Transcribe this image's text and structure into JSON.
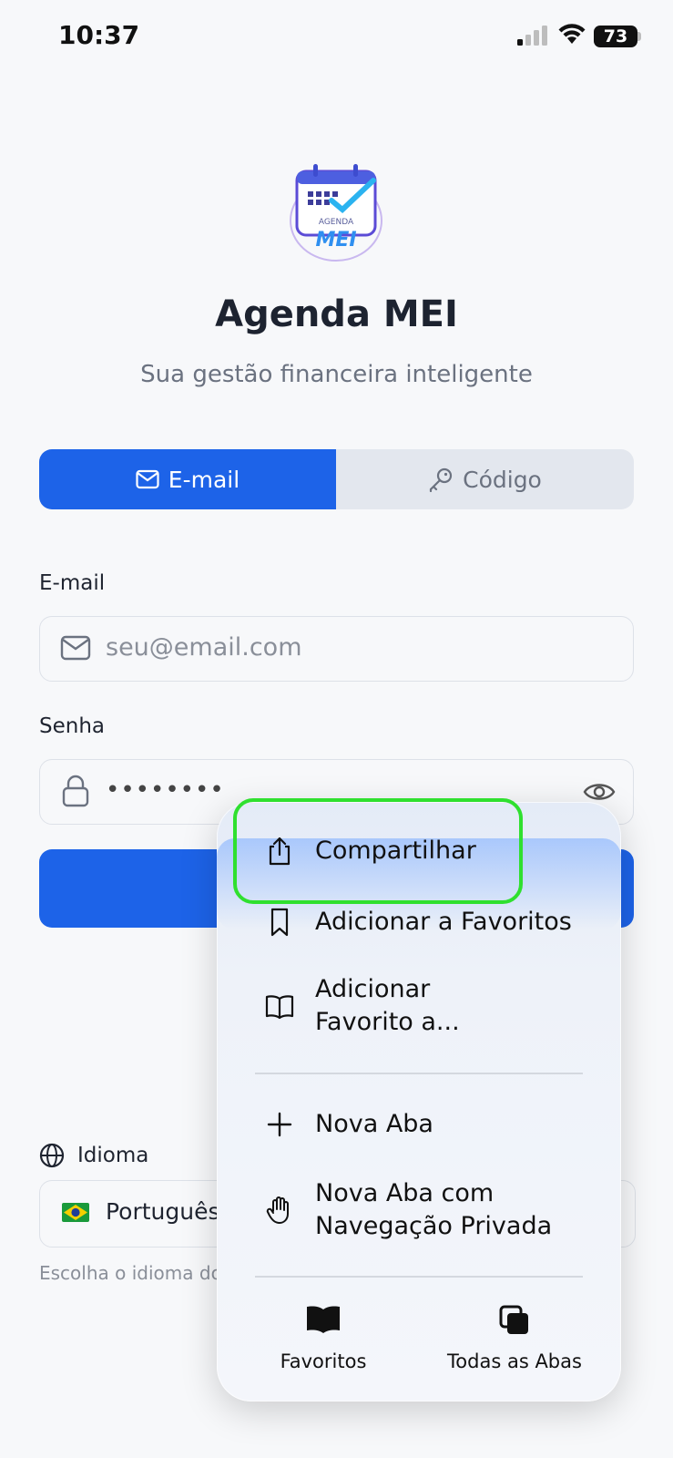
{
  "status": {
    "time": "10:37",
    "battery": "73"
  },
  "app": {
    "logo_top": "AGENDA",
    "logo_main": "MEI",
    "title": "Agenda MEI",
    "subtitle": "Sua gestão financeira inteligente"
  },
  "tabs": {
    "email": "E-mail",
    "code": "Código"
  },
  "form": {
    "email_label": "E-mail",
    "email_placeholder": "seu@email.com",
    "password_label": "Senha",
    "password_value": "••••••••"
  },
  "language": {
    "label": "Idioma",
    "value": "Português",
    "hint": "Escolha o idioma do"
  },
  "menu": {
    "items": [
      {
        "label": "Compartilhar",
        "icon": "share-icon"
      },
      {
        "label": "Adicionar a Favoritos",
        "icon": "bookmark-icon"
      },
      {
        "label_line1": "Adicionar",
        "label_line2": "Favorito a...",
        "icon": "book-icon"
      },
      {
        "label": "Nova Aba",
        "icon": "plus-icon"
      },
      {
        "label_line1": "Nova Aba com",
        "label_line2": "Navegação Privada",
        "icon": "hand-icon"
      }
    ],
    "bottom": [
      {
        "label": "Favoritos",
        "icon": "favorites-book-icon"
      },
      {
        "label": "Todas as Abas",
        "icon": "tabs-icon"
      }
    ]
  },
  "colors": {
    "primary": "#1d63e8",
    "highlight": "#2fe02f"
  }
}
